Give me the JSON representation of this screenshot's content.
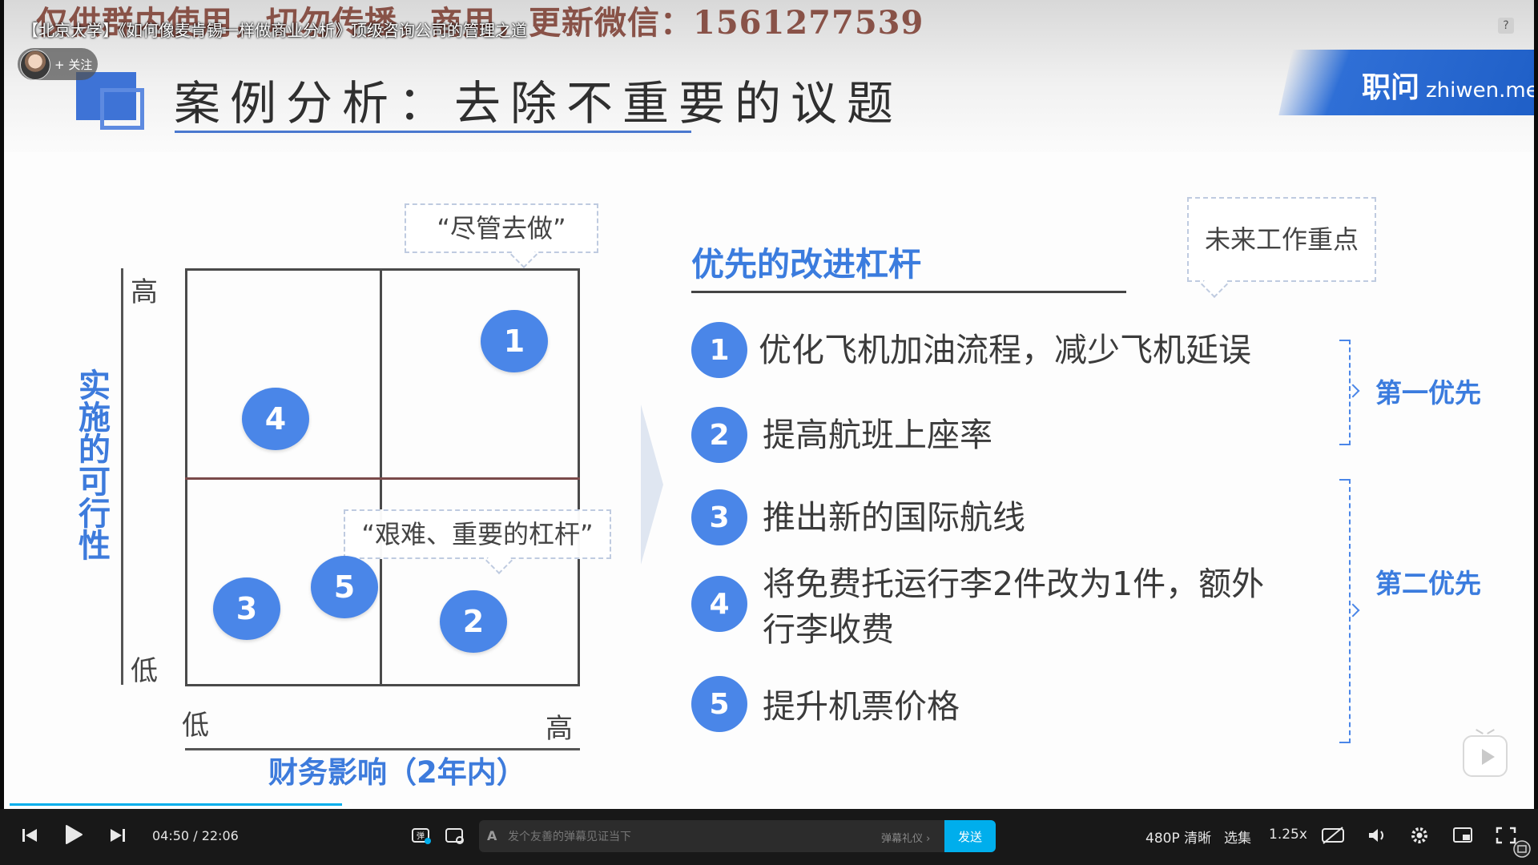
{
  "video": {
    "title": "【北京大学】《如何像麦肯锡一样做商业分析》顶级咨询公司的管理之道",
    "watermark": "仅供群内使用，切勿传播，商用，更新微信：1561277539",
    "follow_label": "+ 关注",
    "help_icon_text": "?"
  },
  "slide": {
    "title": "案例分析：去除不重要的议题",
    "brand_main": "职问",
    "brand_sub": "zhiwen.me",
    "matrix": {
      "y_axis_title": "实施的可行性",
      "x_axis_title": "财务影响（2年内）",
      "y_high": "高",
      "y_low": "低",
      "x_low": "低",
      "x_high": "高",
      "callout_top": "“尽管去做”",
      "callout_mid": "“艰难、重要的杠杆”",
      "bubbles": [
        "1",
        "4",
        "3",
        "5",
        "2"
      ]
    },
    "list": {
      "title": "优先的改进杠杆",
      "callout": "未来工作重点",
      "items": [
        {
          "num": "1",
          "text": "优化飞机加油流程，减少飞机延误"
        },
        {
          "num": "2",
          "text": "提高航班上座率"
        },
        {
          "num": "3",
          "text": "推出新的国际航线"
        },
        {
          "num": "4",
          "text_line1": "将免费托运行李2件改为1件，额外",
          "text_line2": "行李收费"
        },
        {
          "num": "5",
          "text": "提升机票价格"
        }
      ],
      "priority_1": "第一优先",
      "priority_2": "第二优先"
    }
  },
  "player": {
    "current_time": "04:50",
    "separator": "/",
    "duration": "22:06",
    "progress_fraction": 0.219,
    "buffer_fraction": 0.225,
    "danmaku_placeholder": "发个友善的弹幕见证当下",
    "danmaku_etiquette": "弹幕礼仪 ›",
    "send_label": "发送",
    "quality": "480P 清晰",
    "episodes": "选集",
    "speed": "1.25x",
    "accent_color": "#00aeec"
  }
}
